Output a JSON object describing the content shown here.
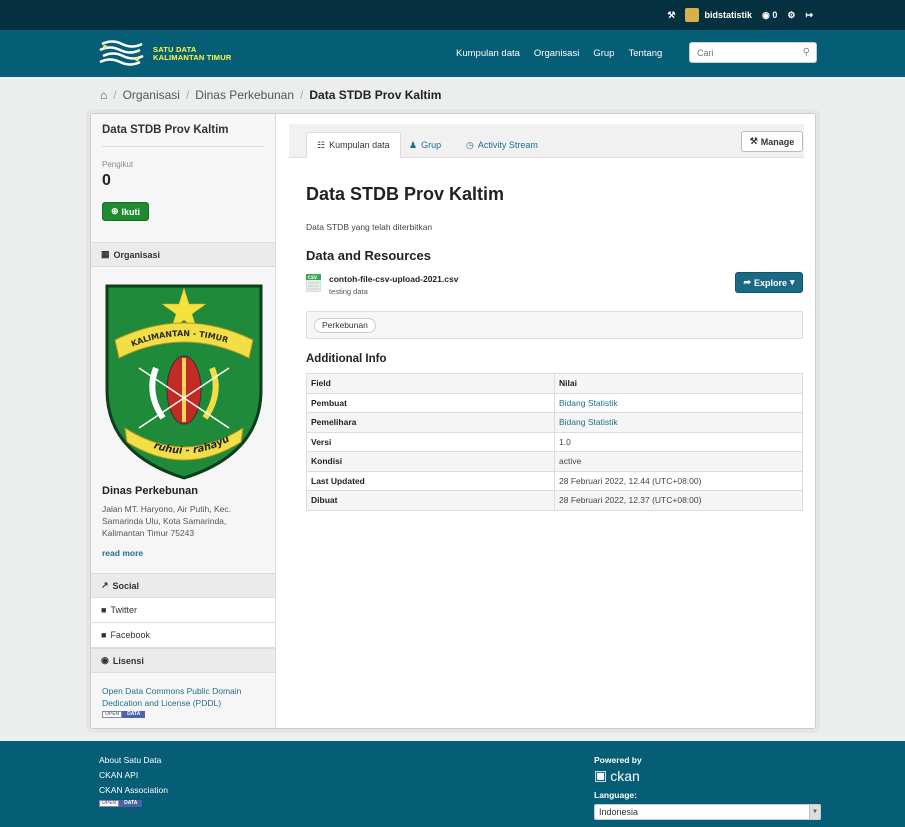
{
  "account": {
    "username": "bidstatistik",
    "dashboard_count": "0"
  },
  "masthead": {
    "logo_line1": "SATU DATA",
    "logo_line2": "KALIMANTAN TIMUR",
    "nav": [
      "Kumpulan data",
      "Organisasi",
      "Grup",
      "Tentang"
    ],
    "search_placeholder": "Cari"
  },
  "breadcrumb": {
    "items": [
      "Organisasi",
      "Dinas Perkebunan"
    ],
    "active": "Data STDB Prov Kaltim"
  },
  "sidebar": {
    "title": "Data STDB Prov Kaltim",
    "followers_label": "Pengikut",
    "followers_count": "0",
    "follow_label": "Ikuti",
    "org_heading": "Organisasi",
    "emblem_text": "KALIMANTAN - TIMUR",
    "emblem_motto": "ruhui - rahayu",
    "org_name": "Dinas Perkebunan",
    "org_description": "Jalan MT. Haryono, Air Putih, Kec. Samarinda Ulu, Kota Samarinda, Kalimantan Timur 75243",
    "read_more": "read more",
    "social_heading": "Social",
    "twitter": "Twitter",
    "facebook": "Facebook",
    "license_heading": "Lisensi",
    "license_text": "Open Data Commons Public Domain Dedication and License (PDDL)",
    "open_badge_1": "OPEN",
    "open_badge_2": "DATA"
  },
  "tabs": {
    "datasets": "Kumpulan data",
    "groups": "Grup",
    "activity": "Activity Stream",
    "manage": "Manage"
  },
  "dataset": {
    "title": "Data STDB Prov Kaltim",
    "notes": "Data STDB yang telah diterbitkan",
    "resources_heading": "Data and Resources",
    "resource_format": "CSV",
    "resource_name": "contoh-file-csv-upload-2021.csv",
    "resource_description": "testing data",
    "explore_label": "Explore",
    "tag": "Perkebunan",
    "additional_info_heading": "Additional Info",
    "table_headers": [
      "Field",
      "Nilai"
    ],
    "table_rows": [
      {
        "field": "Pembuat",
        "value": "Bidang Statistik"
      },
      {
        "field": "Pemelihara",
        "value": "Bidang Statistik"
      },
      {
        "field": "Versi",
        "value": "1.0"
      },
      {
        "field": "Kondisi",
        "value": "active"
      },
      {
        "field": "Last Updated",
        "value": "28 Februari 2022, 12.44 (UTC+08:00)"
      },
      {
        "field": "Dibuat",
        "value": "28 Februari 2022, 12.37 (UTC+08:00)"
      }
    ]
  },
  "footer": {
    "links": [
      "About Satu Data",
      "CKAN API",
      "CKAN Association"
    ],
    "powered_by": "Powered by",
    "ckan": "ckan",
    "language_label": "Language:",
    "language_value": "Indonesia",
    "open_badge_1": "OPEN",
    "open_badge_2": "DATA"
  },
  "colors": {
    "masthead": "#055d76",
    "account_bar": "#04303f",
    "link": "#1f6e8c",
    "follow_button": "#1f8a30",
    "explore_button": "#1a6a86"
  }
}
